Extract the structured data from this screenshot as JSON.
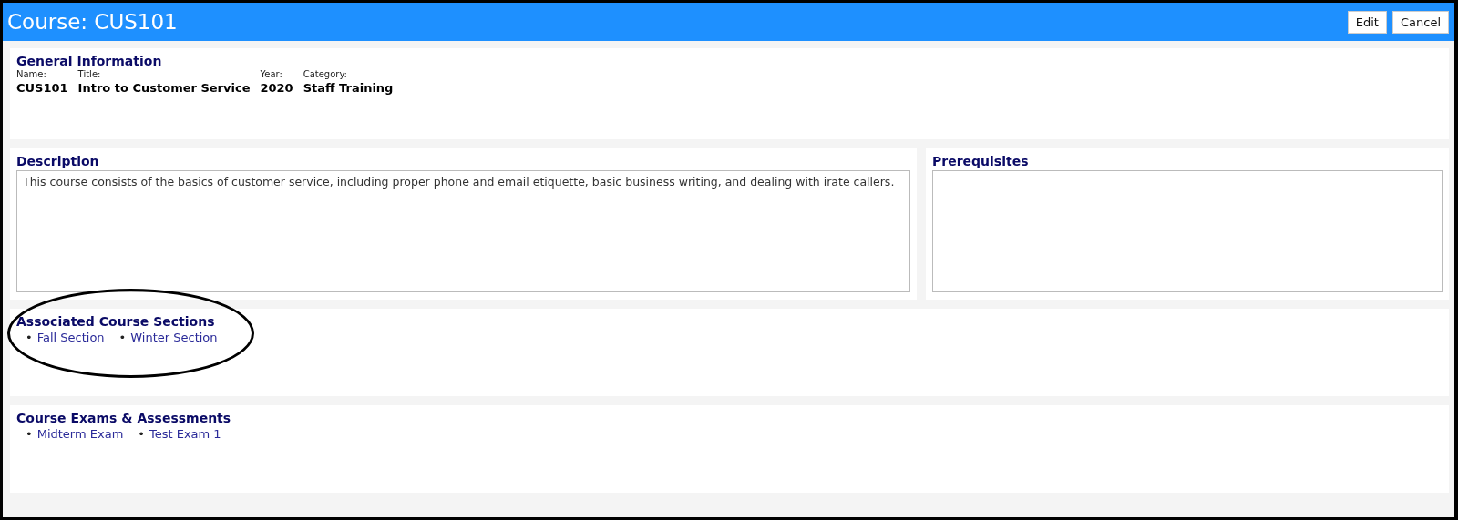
{
  "header": {
    "title": "Course: CUS101",
    "buttons": [
      "Edit",
      "Cancel"
    ]
  },
  "general": {
    "heading": "General Information",
    "fields": [
      {
        "label": "Name:",
        "value": "CUS101"
      },
      {
        "label": "Title:",
        "value": "Intro to Customer Service"
      },
      {
        "label": "Year:",
        "value": "2020"
      },
      {
        "label": "Category:",
        "value": "Staff Training"
      }
    ]
  },
  "description": {
    "heading": "Description",
    "value": "This course consists of the basics of customer service, including proper phone and email etiquette, basic business writing, and dealing with irate callers."
  },
  "prerequisites": {
    "heading": "Prerequisites"
  },
  "lists": [
    {
      "heading": "Associated Course Sections",
      "circled": true,
      "items": [
        {
          "bullet": "•",
          "label": "Fall Section"
        },
        {
          "bullet": "•",
          "label": "Winter Section"
        }
      ]
    },
    {
      "heading": "Course Exams & Assessments",
      "circled": false,
      "items": [
        {
          "bullet": "•",
          "label": "Midterm Exam"
        },
        {
          "bullet": "•",
          "label": "Test Exam 1"
        }
      ]
    }
  ]
}
